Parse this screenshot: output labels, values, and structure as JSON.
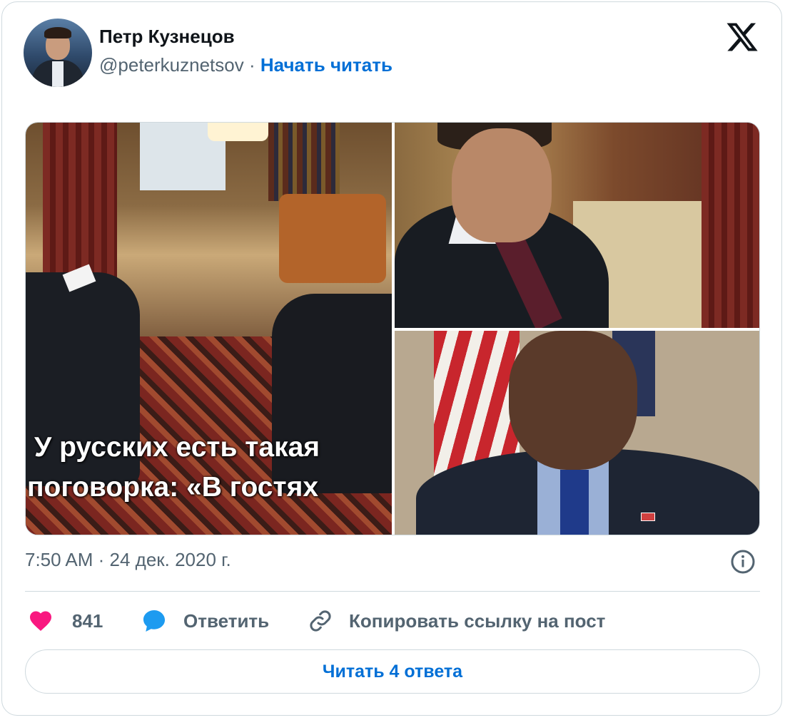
{
  "author": {
    "name": "Петр Кузнецов",
    "handle": "@peterkuznetsov",
    "separator": "·",
    "follow_label": "Начать читать"
  },
  "media": {
    "caption_line1": "У русских есть такая",
    "caption_line2": "поговорка: «В гостях"
  },
  "meta": {
    "timestamp": "7:50 AM · 24 дек. 2020 г."
  },
  "actions": {
    "likes": "841",
    "reply_label": "Ответить",
    "copy_label": "Копировать ссылку на пост"
  },
  "read_replies_label": "Читать 4 ответа",
  "colors": {
    "accent": "#006fd6",
    "like": "#f91880",
    "reply": "#1d9bf0",
    "muted": "#536471",
    "border": "#cfd9de"
  },
  "icons": {
    "logo": "x-logo-icon",
    "info": "info-icon",
    "like": "heart-icon",
    "reply": "speech-bubble-icon",
    "copy": "link-icon"
  }
}
